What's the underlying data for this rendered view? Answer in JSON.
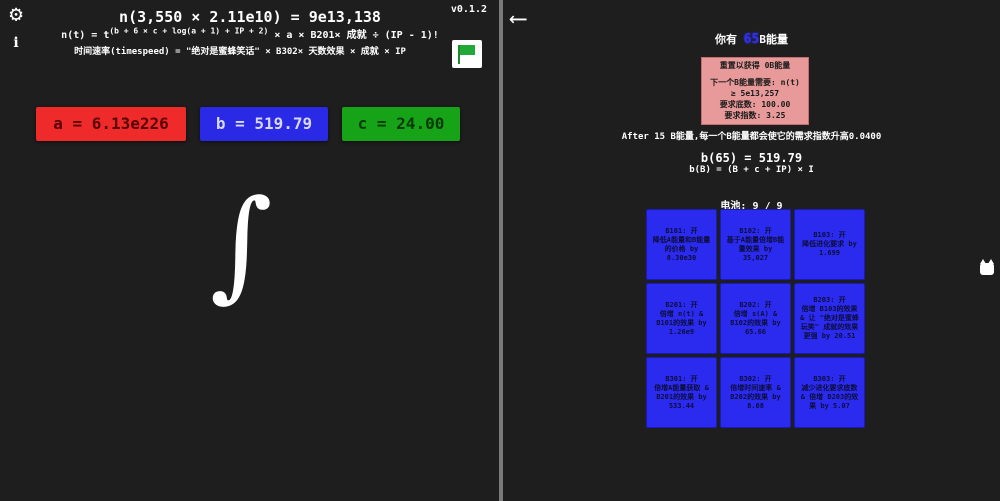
{
  "version": "v0.1.2",
  "header": {
    "title_equation": "n(3,550 × 2.11e10) = 9e13,138",
    "formula_prefix": "n(t) = t",
    "formula_exponent": "(b + 6 × c + log(a + 1) + IP + 2)",
    "formula_suffix": "× a × B201× 成就 ÷ (IP - 1)!",
    "timespeed_formula": "时间速率(timespeed) = \"绝对是蜜蜂笑话\" × B302× 天数效果 × 成就 × IP"
  },
  "variables": {
    "a": "a = 6.13e226",
    "b": "b = 519.79",
    "c": "c = 24.00"
  },
  "integral_symbol": "∫",
  "energy": {
    "prefix": "你有",
    "value": "65",
    "suffix": "B能量"
  },
  "reset": {
    "title": "重置以获得 0B能量",
    "next_label": "下一个B能量需要: n(t)",
    "next_value": "≥ 5e13,257",
    "base": "要求底数: 100.00",
    "exponent": "要求指数: 3.25"
  },
  "after_text": "After 15 B能量,每一个B能量都会使它的需求指数升高0.0400",
  "b_value": "b(65) = 519.79",
  "b_formula": "b(B) = (B + c + IP) × I",
  "battery": "电池: 9 / 9",
  "upgrades": [
    {
      "id": "B101: 开",
      "desc": "降低A能量和B能量的价格 by 8.30e30"
    },
    {
      "id": "B102: 开",
      "desc": "基于A能量倍增B能量效果 by 35,027"
    },
    {
      "id": "B103: 开",
      "desc": "降低进化要求 by 1.699"
    },
    {
      "id": "B201: 开",
      "desc": "倍增 n(t) & B101的效果 by 1.26e9"
    },
    {
      "id": "B202: 开",
      "desc": "倍增 s(A) & B102的效果 by 65.66"
    },
    {
      "id": "B203: 开",
      "desc": "倍增 B103的效果 & 让 \"绝对是蜜蜂玩笑\" 成就的效果更强 by 20.51"
    },
    {
      "id": "B301: 开",
      "desc": "倍增A能量获取 & B201的效果 by 533.44"
    },
    {
      "id": "B302: 开",
      "desc": "倍增时间速率 & B202的效果 by 8.08"
    },
    {
      "id": "B303: 开",
      "desc": "减少进化要求底数 & 倍增 B203的效果 by 5.07"
    }
  ],
  "colors": {
    "var_a": "#ef2a2a",
    "var_b": "#2929e6",
    "var_c": "#17a317",
    "upgrade": "#2b2bf0",
    "reset_box": "#e89a9a",
    "energy_value": "#3030f0"
  },
  "icons": [
    "gear-icon",
    "info-icon",
    "discord-icon",
    "flag-icon",
    "back-arrow-icon",
    "cat-icon"
  ]
}
